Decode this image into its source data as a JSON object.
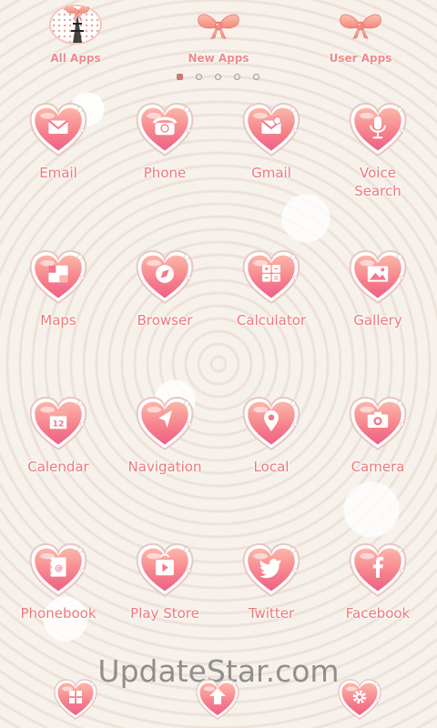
{
  "tabs": [
    {
      "label": "All Apps",
      "icon": "eiffel-bow-icon"
    },
    {
      "label": "New Apps",
      "icon": "bow-icon"
    },
    {
      "label": "User Apps",
      "icon": "bow-icon"
    }
  ],
  "pager": {
    "pages": 5,
    "current": 1
  },
  "apps": [
    {
      "label": "Email",
      "icon": "envelope-icon"
    },
    {
      "label": "Phone",
      "icon": "telephone-icon"
    },
    {
      "label": "Gmail",
      "icon": "gmail-envelope-icon"
    },
    {
      "label": "Voice\nSearch",
      "icon": "microphone-icon"
    },
    {
      "label": "Maps",
      "icon": "map-icon"
    },
    {
      "label": "Browser",
      "icon": "compass-icon"
    },
    {
      "label": "Calculator",
      "icon": "calculator-icon"
    },
    {
      "label": "Gallery",
      "icon": "picture-icon"
    },
    {
      "label": "Calendar",
      "icon": "calendar-icon"
    },
    {
      "label": "Navigation",
      "icon": "navigation-arrow-icon"
    },
    {
      "label": "Local",
      "icon": "location-pin-icon"
    },
    {
      "label": "Camera",
      "icon": "camera-icon"
    },
    {
      "label": "Phonebook",
      "icon": "contacts-book-icon"
    },
    {
      "label": "Play Store",
      "icon": "play-store-icon"
    },
    {
      "label": "Twitter",
      "icon": "twitter-bird-icon"
    },
    {
      "label": "Facebook",
      "icon": "facebook-icon"
    }
  ],
  "dock": [
    {
      "icon": "app-grid-icon"
    },
    {
      "icon": "home-arrow-icon"
    },
    {
      "icon": "gear-icon"
    }
  ],
  "watermark": "UpdateStar.com",
  "colors": {
    "heart_pink": "#f3708a",
    "heart_light": "#fbb7b0",
    "label_pink": "#f07878",
    "bow": "#f7a08c"
  }
}
